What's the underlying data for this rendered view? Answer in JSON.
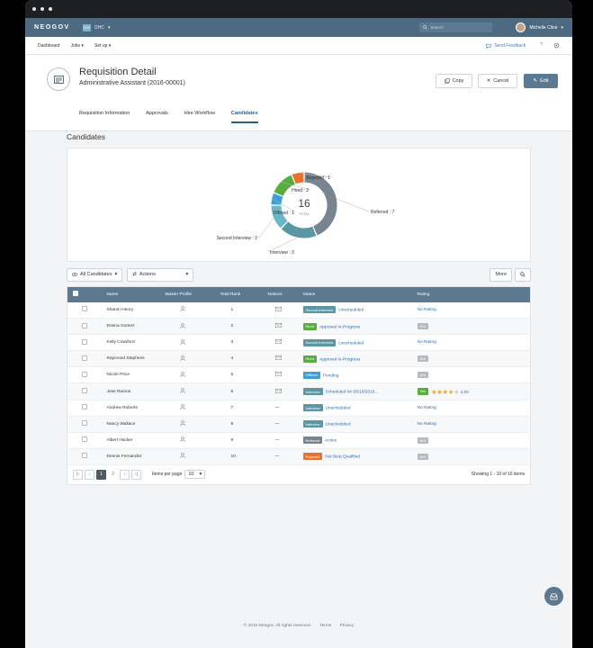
{
  "topbar": {
    "brand": "NEOGOV",
    "org_initials": "OHC",
    "org_name": "OHC",
    "search_placeholder": "Search",
    "user_name": "Michelle Cline"
  },
  "nav": {
    "items": [
      "Dashboard",
      "Jobs",
      "Set up"
    ],
    "feedback": "Send Feedback"
  },
  "header": {
    "title": "Requisition Detail",
    "subtitle": "Administrative Assistant (2016-00001)",
    "copy": "Copy",
    "cancel": "Cancel",
    "edit": "Edit"
  },
  "tabs": [
    "Requisition Information",
    "Approvals",
    "Hire Workflow",
    "Candidates"
  ],
  "section_title": "Candidates",
  "chart_data": {
    "type": "pie",
    "variant": "donut",
    "center_value": "16",
    "center_label": "TOTAL",
    "slices": [
      {
        "label": "Referred : 7",
        "value": 7,
        "color": "#788590"
      },
      {
        "label": "Interview : 3",
        "value": 3,
        "color": "#5a96a3"
      },
      {
        "label": "Second Interview : 2",
        "value": 2,
        "color": "#6cb7c7"
      },
      {
        "label": "Offered : 1",
        "value": 1,
        "color": "#3ba0d6"
      },
      {
        "label": "Hired : 2",
        "value": 2,
        "color": "#57ad3d"
      },
      {
        "label": "Rejected : 1",
        "value": 1,
        "color": "#e8722a"
      }
    ]
  },
  "toolbar": {
    "filter": "All Candidates",
    "actions": "Actions",
    "more": "More"
  },
  "table": {
    "headers": [
      "Name",
      "Master Profile",
      "Total Rank",
      "Notices",
      "Status",
      "Rating"
    ],
    "rows": [
      {
        "name": "Sharon Henry",
        "rank": "1",
        "notice": "mail",
        "badge": "Second Interview",
        "badge_color": "#5a96a3",
        "status": "Unscheduled",
        "rating": "No Rating"
      },
      {
        "name": "Donna Gomez",
        "rank": "2",
        "notice": "mail",
        "badge": "Hired",
        "badge_color": "#57ad3d",
        "status": "Approval In-Progress",
        "rating": "N/A"
      },
      {
        "name": "Kelly Crawford",
        "rank": "3",
        "notice": "mail",
        "badge": "Second Interview",
        "badge_color": "#5a96a3",
        "status": "Unscheduled",
        "rating": "No Rating"
      },
      {
        "name": "Raymond Stephens",
        "rank": "4",
        "notice": "mail",
        "badge": "Hired",
        "badge_color": "#57ad3d",
        "status": "Approval In-Progress",
        "rating": "N/A"
      },
      {
        "name": "Nicole Price",
        "rank": "5",
        "notice": "mail",
        "badge": "Offered",
        "badge_color": "#3ba0d6",
        "status": "Pending",
        "rating": "N/A"
      },
      {
        "name": "Jose Ramos",
        "rank": "6",
        "notice": "mail",
        "badge": "Interview",
        "badge_color": "#5a96a3",
        "status": "Scheduled for 05/19/2016...",
        "rating": "stars",
        "rating_tag": "Yes",
        "rating_stars": 4,
        "rating_value": "4.00"
      },
      {
        "name": "Andrew Roberts",
        "rank": "7",
        "notice": "—",
        "badge": "Interview",
        "badge_color": "#5a96a3",
        "status": "Unscheduled",
        "rating": "No Rating"
      },
      {
        "name": "Nancy Wallace",
        "rank": "8",
        "notice": "—",
        "badge": "Interview",
        "badge_color": "#5a96a3",
        "status": "Unscheduled",
        "rating": "No Rating"
      },
      {
        "name": "Albert Hacker",
        "rank": "9",
        "notice": "—",
        "badge": "Referred",
        "badge_color": "#788590",
        "status": "Active",
        "rating": "N/A"
      },
      {
        "name": "Dennis Fernandez",
        "rank": "10",
        "notice": "—",
        "badge": "Rejected",
        "badge_color": "#e8722a",
        "status": "Not Best Qualified",
        "rating": "N/A"
      }
    ]
  },
  "pager": {
    "pages": [
      "1",
      "2"
    ],
    "current": "1",
    "items_per_page_label": "Items per page",
    "items_per_page": "10",
    "summary": "Showing 1 - 10 of 16 items"
  },
  "footer": {
    "copyright": "© 2015 Neogov. All rights reserved.",
    "terms": "Terms",
    "privacy": "Privacy"
  }
}
